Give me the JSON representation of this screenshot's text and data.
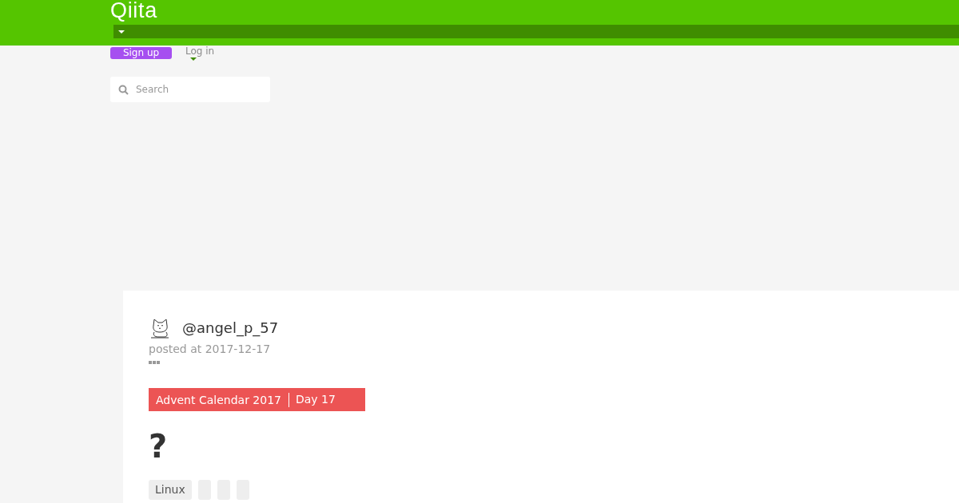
{
  "header": {
    "logo": "Qiita",
    "signup": "Sign up",
    "login": "Log in"
  },
  "search": {
    "placeholder": "Search"
  },
  "article": {
    "author": "@angel_p_57",
    "posted": "posted at 2017-12-17",
    "calendar": {
      "name": "Advent Calendar 2017",
      "day": "Day 17"
    },
    "title": "?",
    "tags": [
      {
        "kind": "text",
        "label": "Linux"
      },
      {
        "kind": "blank"
      },
      {
        "kind": "blank"
      },
      {
        "kind": "blank"
      }
    ]
  }
}
